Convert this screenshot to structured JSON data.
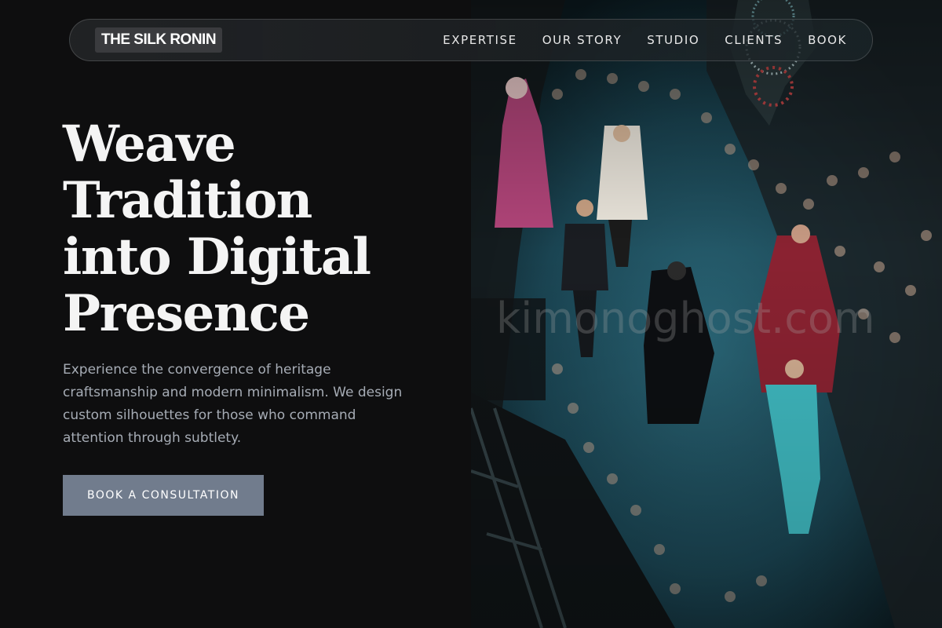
{
  "navbar": {
    "logo": "THE SILK RONIN",
    "links": [
      {
        "label": "EXPERTISE"
      },
      {
        "label": "OUR STORY"
      },
      {
        "label": "STUDIO"
      },
      {
        "label": "CLIENTS"
      },
      {
        "label": "BOOK"
      }
    ]
  },
  "hero": {
    "title_lines": [
      "Weave",
      "Tradition",
      "into Digital",
      "Presence"
    ],
    "description": "Experience the convergence of heritage craftsmanship and modern minimalism. We design custom silhouettes for those who command attention through subtlety.",
    "cta_label": "BOOK A CONSULTATION"
  },
  "image": {
    "watermark": "kimonoghost.com"
  },
  "colors": {
    "background": "#0e0e0f",
    "button": "#717c8d",
    "description_text": "#a6acb5",
    "runway_teal": "#1d4e5c"
  }
}
